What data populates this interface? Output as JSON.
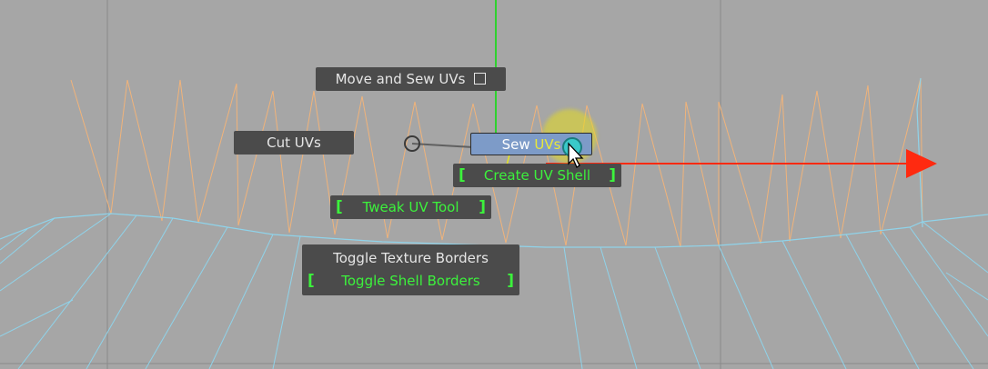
{
  "marking_menu": {
    "move_and_sew": "Move and Sew UVs",
    "cut_uvs": "Cut UVs",
    "sew_uvs_prefix": "Sew ",
    "sew_uvs_suffix": "UVs",
    "create_uv_shell": "Create UV Shell",
    "tweak_uv_tool": "Tweak UV Tool",
    "toggle_texture_borders": "Toggle Texture Borders",
    "toggle_shell_borders": "Toggle Shell Borders"
  },
  "colors": {
    "viewport_bg": "#a6a6a6",
    "mesh_orange": "#f0b37a",
    "mesh_cyan": "#8fd3ea",
    "y_axis": "#2fd12f",
    "x_axis": "#ff2a10",
    "menu_bg": "#4b4b4b",
    "hotkey_green": "#3cf23c",
    "highlight": "#7d9bc8"
  },
  "icons": [
    "checkbox-icon",
    "cursor-arrow-icon",
    "manipulator-arrow-icon"
  ]
}
